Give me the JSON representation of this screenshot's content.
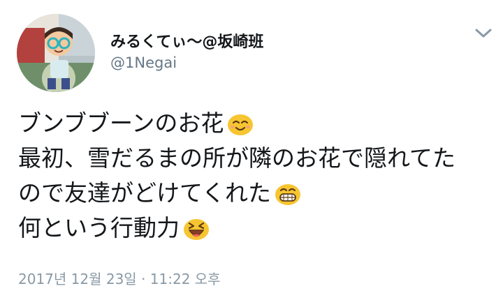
{
  "user": {
    "display_name": "みるくてぃ〜@坂崎班",
    "handle": "@1Negai"
  },
  "tweet": {
    "lines": [
      {
        "text": "ブンブブーンのお花",
        "emoji": "smiling-face-icon"
      },
      {
        "text": "最初、雪だるまの所が隣のお花で隠れてた",
        "emoji": ""
      },
      {
        "text": "ので友達がどけてくれた",
        "emoji": "grinning-face-icon"
      },
      {
        "text": "何という行動力",
        "emoji": "laughing-face-icon"
      }
    ],
    "timestamp": "2017년 12월 23일 · 11:22 오후"
  },
  "colors": {
    "text": "#14171a",
    "handle": "#657786",
    "timestamp": "#8899a6",
    "emoji_yellow": "#f7c531"
  }
}
